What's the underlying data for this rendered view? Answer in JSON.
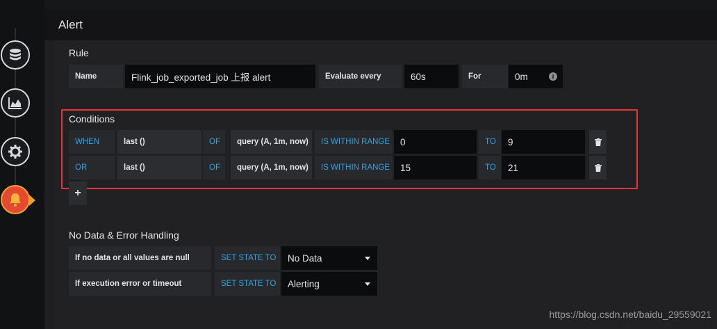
{
  "sidebar": {
    "tabs": [
      {
        "icon": "database-icon"
      },
      {
        "icon": "area-chart-icon"
      },
      {
        "icon": "gear-icon"
      },
      {
        "icon": "bell-icon",
        "active": true
      }
    ]
  },
  "panel": {
    "title": "Alert"
  },
  "rule": {
    "section_title": "Rule",
    "name_label": "Name",
    "name_value": "Flink_job_exported_job 上报 alert",
    "evaluate_label": "Evaluate every",
    "evaluate_value": "60s",
    "for_label": "For",
    "for_value": "0m"
  },
  "conditions": {
    "section_title": "Conditions",
    "rows": [
      {
        "operator": "WHEN",
        "reducer": "last ()",
        "of": "OF",
        "query": "query (A, 1m, now)",
        "evaluator": "IS WITHIN RANGE",
        "from": "0",
        "to_label": "TO",
        "to": "9"
      },
      {
        "operator": "OR",
        "reducer": "last ()",
        "of": "OF",
        "query": "query (A, 1m, now)",
        "evaluator": "IS WITHIN RANGE",
        "from": "15",
        "to_label": "TO",
        "to": "21"
      }
    ],
    "add_label": "+"
  },
  "nodata": {
    "section_title": "No Data & Error Handling",
    "rows": [
      {
        "label": "If no data or all values are null",
        "set_state": "SET STATE TO",
        "value": "No Data"
      },
      {
        "label": "If execution error or timeout",
        "set_state": "SET STATE TO",
        "value": "Alerting"
      }
    ]
  },
  "watermark": "https://blog.csdn.net/baidu_29559021",
  "colors": {
    "accent_blue": "#33a2e5",
    "highlight_red": "#e8343a",
    "active_tab": "#e5492f"
  }
}
